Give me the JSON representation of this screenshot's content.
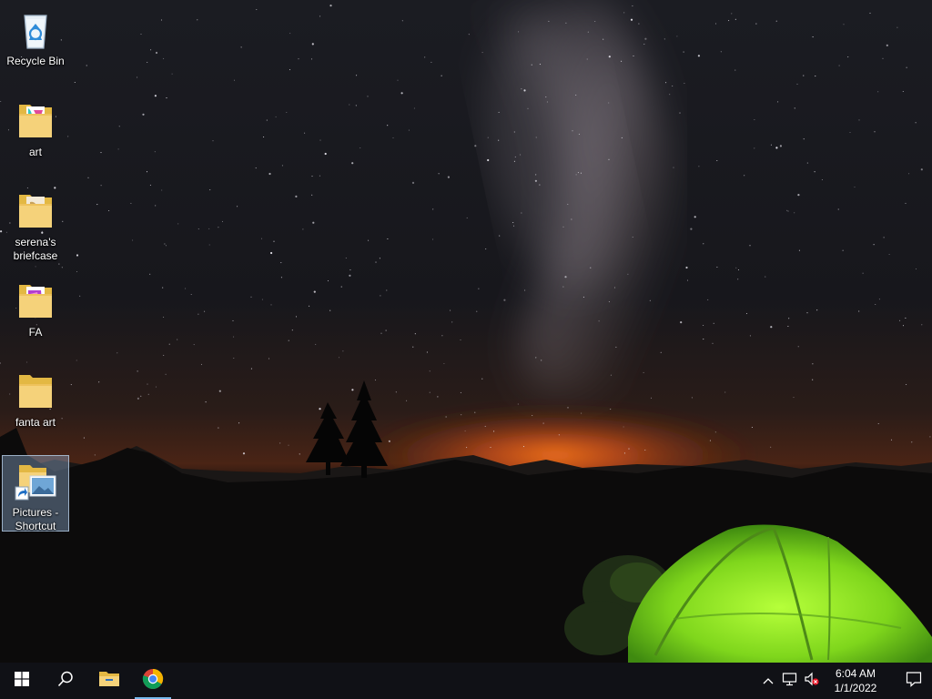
{
  "desktop": {
    "icons": [
      {
        "label": "Recycle Bin",
        "icon": "recycle-bin-icon"
      },
      {
        "label": "art",
        "icon": "folder-icon"
      },
      {
        "label": "serena's briefcase",
        "icon": "folder-icon"
      },
      {
        "label": "FA",
        "icon": "folder-icon"
      },
      {
        "label": "fanta art",
        "icon": "folder-icon"
      },
      {
        "label": "Pictures - Shortcut",
        "icon": "pictures-shortcut-icon",
        "selected": true
      }
    ]
  },
  "taskbar": {
    "pinned": [
      {
        "name": "start-button",
        "icon": "windows-logo-icon"
      },
      {
        "name": "search-button",
        "icon": "search-icon"
      },
      {
        "name": "file-explorer-button",
        "icon": "file-explorer-icon"
      },
      {
        "name": "chrome-button",
        "icon": "chrome-icon",
        "active": true
      }
    ],
    "clock": {
      "time": "6:04 AM",
      "date": "1/1/2022"
    },
    "accent": "#76b9ed"
  }
}
